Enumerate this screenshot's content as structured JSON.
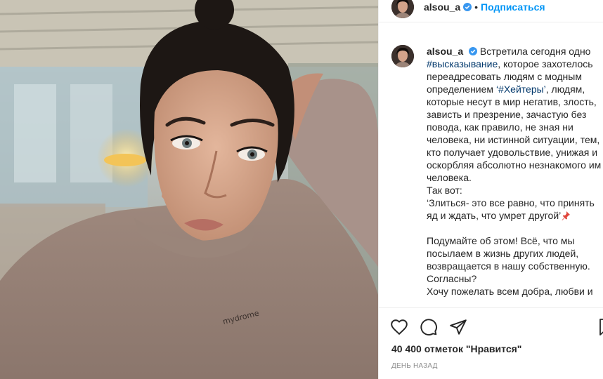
{
  "post": {
    "username": "alsou_a",
    "verified": true,
    "follow_label": "Подписаться",
    "separator": "•",
    "shirt_print": "mydrome",
    "caption": {
      "username": "alsou_a",
      "line1": "Встретила сегодня одно",
      "hashtag1": "#высказывание",
      "line2": ", которое захотелось переадресовать людям с модным определением ",
      "hashtag2": "‘#Хейтеры’",
      "line3": ", людям, которые несут в мир негатив, злость, зависть и презрение, зачастую без повода, как правило, не зная ни человека, ни истинной ситуации, тем, кто получает удовольствие, унижая и оскорбляя абсолютно незнакомого им человека.",
      "line4": "Так вот:",
      "quote": "‘Злиться- это все равно, что принять яд и ждать, что умрет другой’",
      "pin_icon": "pushpin-icon",
      "line5": "Подумайте об этом! Всё, что мы посылаем в жизнь других людей, возвращается в нашу собственную. Согласны?",
      "line6": "Хочу пожелать всем добра, любви и"
    },
    "likes": "40 400 отметок \"Нравится\"",
    "date": "ДЕНЬ НАЗАД",
    "icons": {
      "like": "heart-icon",
      "comment": "comment-icon",
      "share": "send-icon",
      "save": "bookmark-icon",
      "verified": "verified-badge-icon"
    },
    "colors": {
      "link": "#00376b",
      "follow": "#0095f6",
      "text": "#262626",
      "muted": "#8e8e8e"
    }
  }
}
